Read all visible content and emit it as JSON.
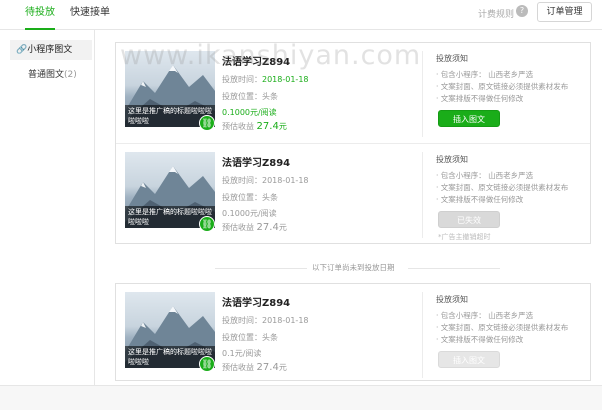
{
  "header": {
    "tabs": [
      {
        "label": "待投放",
        "active": true
      },
      {
        "label": "快速接单",
        "active": false
      }
    ],
    "rules_label": "计费规则",
    "help_glyph": "?",
    "order_manage_label": "订单管理"
  },
  "sidebar": {
    "items": [
      {
        "icon": "link-icon",
        "glyph": "🔗",
        "label": "小程序图文",
        "active": true
      },
      {
        "label": "普通图文",
        "count": "(2)",
        "active": false
      }
    ]
  },
  "watermark": "www.ikanshiyan.com",
  "labels": {
    "time_prefix": "投放时间：",
    "position_prefix": "投放位置：",
    "income_prefix": "预估收益",
    "notice_title": "投放须知",
    "notice_items": [
      "· 包含小程序：   山西老乡严选",
      "· 文案封面、原文链接必须提供素材发布",
      "· 文案排版不得做任何修改"
    ],
    "divider_text": "以下订单尚未到投放日期"
  },
  "orders": [
    {
      "thumb_caption": "这里是推广稿的标题啦啦啦啦啦啦",
      "title": "法语学习Z894",
      "time": "2018-01-18",
      "position": "头条",
      "rate": "0.1000元/阅读",
      "income": "27.4",
      "income_unit": "元",
      "button": "插入图文",
      "button_style": "green",
      "button_note": ""
    },
    {
      "thumb_caption": "这里是推广稿的标题啦啦啦啦啦啦",
      "title": "法语学习Z894",
      "time": "2018-01-18",
      "position": "头条",
      "rate": "0.1000元/阅读",
      "income": "27.4",
      "income_unit": "元",
      "button": "已失效",
      "button_style": "gray",
      "button_note": "*广告主撤销超时"
    },
    {
      "thumb_caption": "这里是推广稿的标题啦啦啦啦啦啦",
      "title": "法语学习Z894",
      "time": "2018-01-18",
      "position": "头条",
      "rate": "0.1元/阅读",
      "income": "27.4",
      "income_unit": "元",
      "button": "插入图文",
      "button_style": "gray-light",
      "button_note": ""
    }
  ],
  "colors": {
    "accent": "#1aad19",
    "muted": "#999999",
    "border": "#e0e0e0"
  }
}
